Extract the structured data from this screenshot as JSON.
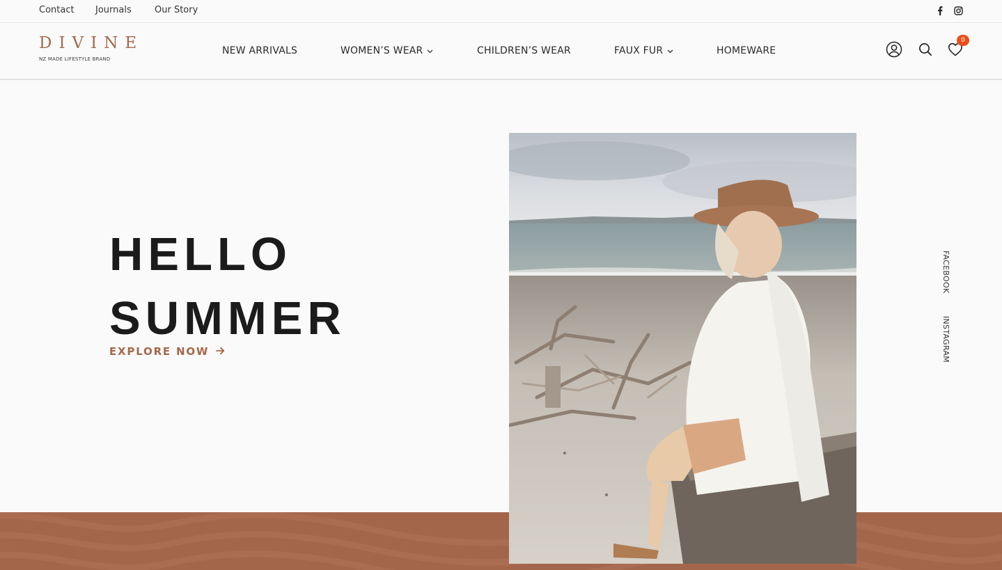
{
  "topbar": {
    "links": [
      "Contact",
      "Journals",
      "Our Story"
    ],
    "social_icons": [
      "facebook-icon",
      "instagram-icon"
    ]
  },
  "logo": {
    "wordmark": "DIVINE",
    "tagline": "NZ MADE LIFESTYLE BRAND"
  },
  "nav": {
    "items": [
      {
        "label": "NEW ARRIVALS",
        "has_dropdown": false
      },
      {
        "label": "WOMEN’S WEAR",
        "has_dropdown": true
      },
      {
        "label": "CHILDREN’S WEAR",
        "has_dropdown": false
      },
      {
        "label": "FAUX FUR",
        "has_dropdown": true
      },
      {
        "label": "HOMEWARE",
        "has_dropdown": false
      }
    ]
  },
  "header_actions": {
    "icons": [
      "account-icon",
      "search-icon",
      "wishlist-heart-icon"
    ],
    "wishlist_count": "0"
  },
  "hero": {
    "title_line1": "HELLO",
    "title_line2": "SUMMER",
    "cta_label": "EXPLORE NOW"
  },
  "side_social": {
    "facebook": "FACEBOOK",
    "instagram": "INSTAGRAM"
  },
  "colors": {
    "accent": "#a3664b",
    "badge": "#e94e1b",
    "background": "#fafafa",
    "text": "#1b1b1b"
  }
}
